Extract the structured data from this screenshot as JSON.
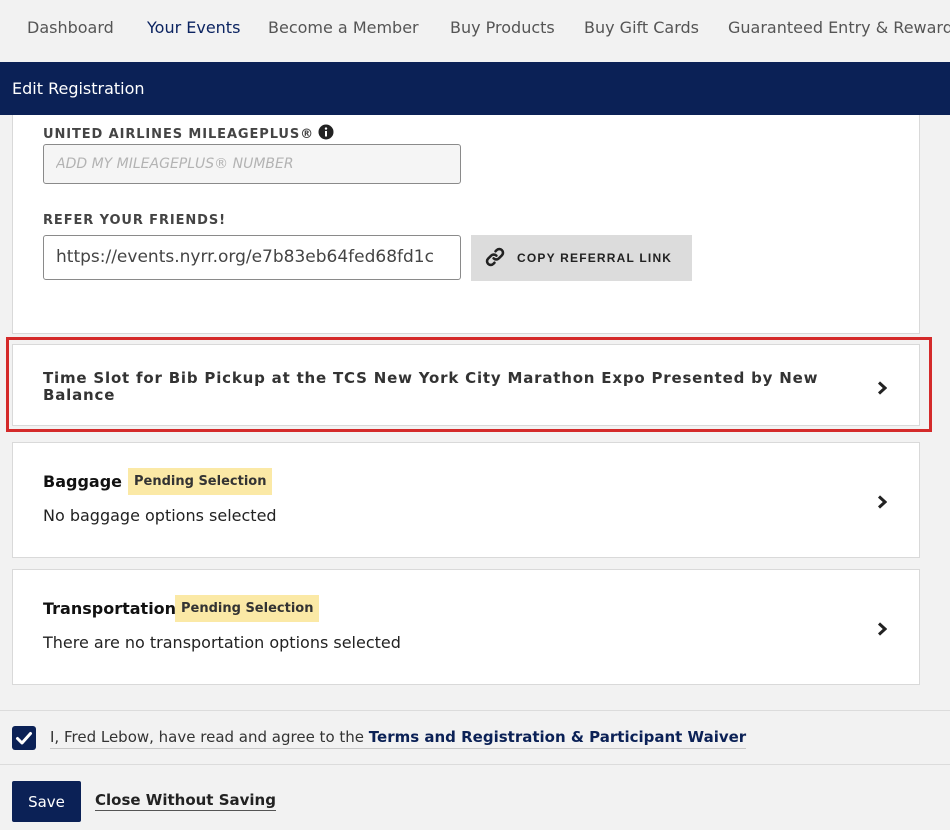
{
  "nav": {
    "items": [
      {
        "label": "Dashboard"
      },
      {
        "label": "Your Events"
      },
      {
        "label": "Become a Member"
      },
      {
        "label": "Buy Products"
      },
      {
        "label": "Buy Gift Cards"
      },
      {
        "label": "Guaranteed Entry & Rewards"
      }
    ],
    "active": "Your Events"
  },
  "header": {
    "title": "Edit Registration"
  },
  "mileageplus": {
    "label": "UNITED AIRLINES MILEAGEPLUS®",
    "placeholder": "ADD MY MILEAGEPLUS® NUMBER",
    "value": ""
  },
  "referral": {
    "label": "REFER YOUR FRIENDS!",
    "link": "https://events.nyrr.org/e7b83eb64fed68fd1c",
    "copy_button": "COPY REFERRAL LINK"
  },
  "bib_pickup": {
    "title": "Time Slot for Bib Pickup at the TCS New York City Marathon Expo Presented by New Balance"
  },
  "baggage": {
    "title": "Baggage",
    "badge": "Pending Selection",
    "description": "No baggage options selected"
  },
  "transportation": {
    "title": "Transportation",
    "badge": "Pending Selection",
    "description": "There are no transportation options selected"
  },
  "agreement": {
    "prefix": "I, Fred Lebow, have read and agree to the ",
    "link": "Terms and Registration & Participant Waiver",
    "checked": true
  },
  "actions": {
    "save": "Save",
    "close": "Close Without Saving"
  },
  "colors": {
    "navy": "#0b2156",
    "badge": "#fbe9a6",
    "highlight": "#d42a2a"
  }
}
